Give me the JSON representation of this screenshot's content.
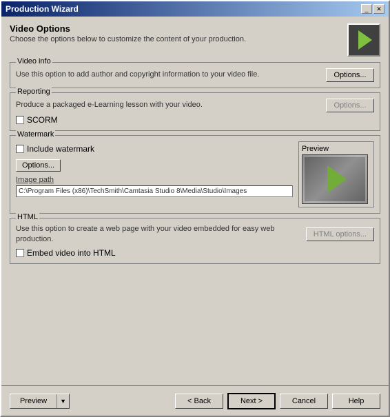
{
  "window": {
    "title": "Production Wizard",
    "title_buttons": [
      "_",
      "X"
    ]
  },
  "header": {
    "title": "Video Options",
    "description": "Choose the options below to customize the content of your production."
  },
  "video_info": {
    "label": "Video info",
    "description": "Use this option to add author and copyright information to your video file.",
    "options_button": "Options..."
  },
  "reporting": {
    "label": "Reporting",
    "description": "Produce a packaged e-Learning lesson with your video.",
    "scorm_label": "SCORM",
    "scorm_checked": false,
    "options_button": "Options..."
  },
  "watermark": {
    "label": "Watermark",
    "include_label": "Include watermark",
    "include_checked": false,
    "options_button": "Options...",
    "image_path_label": "Image path",
    "image_path_value": "C:\\Program Files (x86)\\TechSmith\\Camtasia Studio 8\\Media\\Studio\\Images",
    "preview_label": "Preview"
  },
  "html": {
    "label": "HTML",
    "description": "Use this option to create a web page with your video embedded for easy web production.",
    "embed_label": "Embed video into HTML",
    "embed_checked": false,
    "options_button": "HTML options..."
  },
  "bottom_bar": {
    "preview_button": "Preview",
    "back_button": "< Back",
    "next_button": "Next >",
    "cancel_button": "Cancel",
    "help_button": "Help"
  }
}
